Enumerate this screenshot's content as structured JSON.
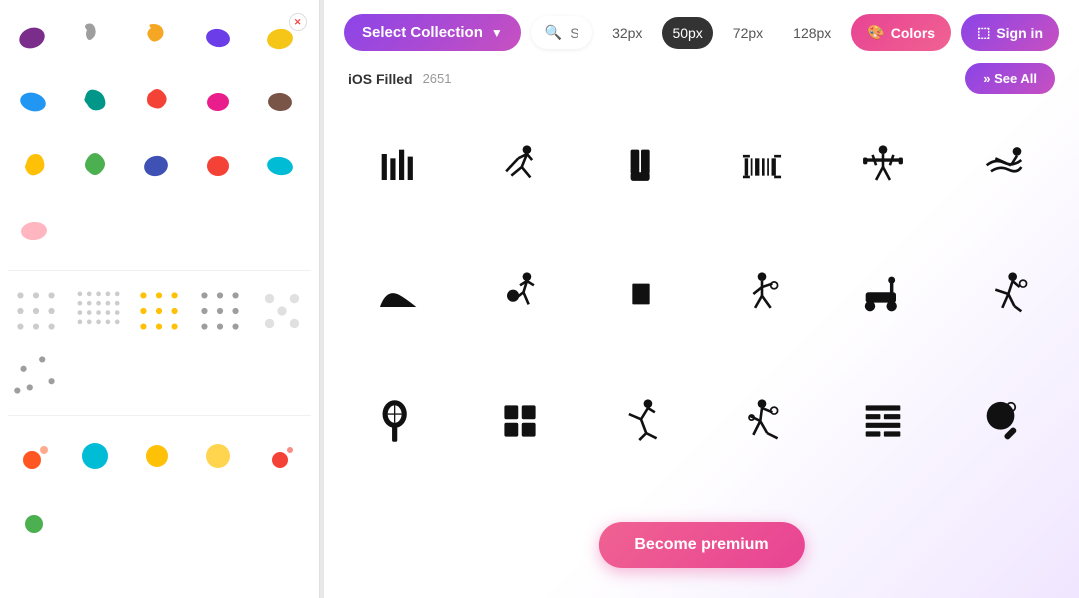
{
  "leftPanel": {
    "blobRows": [
      [
        {
          "color": "#7b2d8b",
          "shape": "blob1"
        },
        {
          "color": "#9e9e9e",
          "shape": "blob2"
        },
        {
          "color": "#f5a623",
          "shape": "blob3"
        },
        {
          "color": "#6a3de8",
          "shape": "blob4"
        },
        {
          "color": "#f5c518",
          "shape": "blob5",
          "hasX": true
        }
      ],
      [
        {
          "color": "#2196f3",
          "shape": "blob6"
        },
        {
          "color": "#009688",
          "shape": "blob7"
        },
        {
          "color": "#f44336",
          "shape": "blob8"
        },
        {
          "color": "#e91e8c",
          "shape": "blob9"
        },
        {
          "color": "#795548",
          "shape": "blob10"
        }
      ],
      [
        {
          "color": "#ffc107",
          "shape": "blob11"
        },
        {
          "color": "#4caf50",
          "shape": "blob12"
        },
        {
          "color": "#3f51b5",
          "shape": "blob13"
        },
        {
          "color": "#f44336",
          "shape": "blob14"
        },
        {
          "color": "#00bcd4",
          "shape": "blob15"
        }
      ],
      [
        {
          "color": "#ffb6c1",
          "shape": "blob16"
        }
      ]
    ],
    "dotRows": [
      [
        {
          "dotColor": "#ccc",
          "pattern": "grid"
        },
        {
          "dotColor": "#ccc",
          "pattern": "grid-sm"
        },
        {
          "dotColor": "#ffc107",
          "pattern": "grid"
        },
        {
          "dotColor": "#9e9e9e",
          "pattern": "grid"
        },
        {
          "dotColor": "#e0e0e0",
          "pattern": "grid-lg"
        }
      ],
      [
        {
          "dotColor": "#9e9e9e",
          "pattern": "scattered"
        }
      ]
    ],
    "circleRows": [
      [
        {
          "color": "#ff5722",
          "size": "md"
        },
        {
          "color": "#00bcd4",
          "size": "lg"
        },
        {
          "color": "#ffc107",
          "size": "md"
        },
        {
          "color": "#ffd54f",
          "size": "md"
        },
        {
          "color": "#f44336",
          "size": "sm"
        }
      ],
      [
        {
          "color": "#4caf50",
          "size": "sm"
        }
      ]
    ]
  },
  "topBar": {
    "selectCollectionLabel": "Select Collection",
    "searchPlaceholder": "Search",
    "sizes": [
      "32px",
      "50px",
      "72px",
      "128px"
    ],
    "activeSize": "50px",
    "colorsLabel": "Colors",
    "signinLabel": "Sign in"
  },
  "subBar": {
    "collectionName": "iOS Filled",
    "count": "2651",
    "seeAllLabel": "» See All"
  },
  "iconGrid": {
    "rows": [
      [
        "barcode-building",
        "cricket-player",
        "baseball-mitt",
        "barcode-scanner",
        "weightlifter",
        "swimmer"
      ],
      [
        "mountain",
        "handball",
        "goal-net",
        "tennis-player",
        "lawn-mower",
        "runner"
      ],
      [
        "tennis-racket",
        "window-grid",
        "gymnast",
        "table-tennis",
        "wall-grid",
        "ping-pong-paddle"
      ]
    ]
  },
  "premiumBanner": {
    "label": "Become premium"
  }
}
